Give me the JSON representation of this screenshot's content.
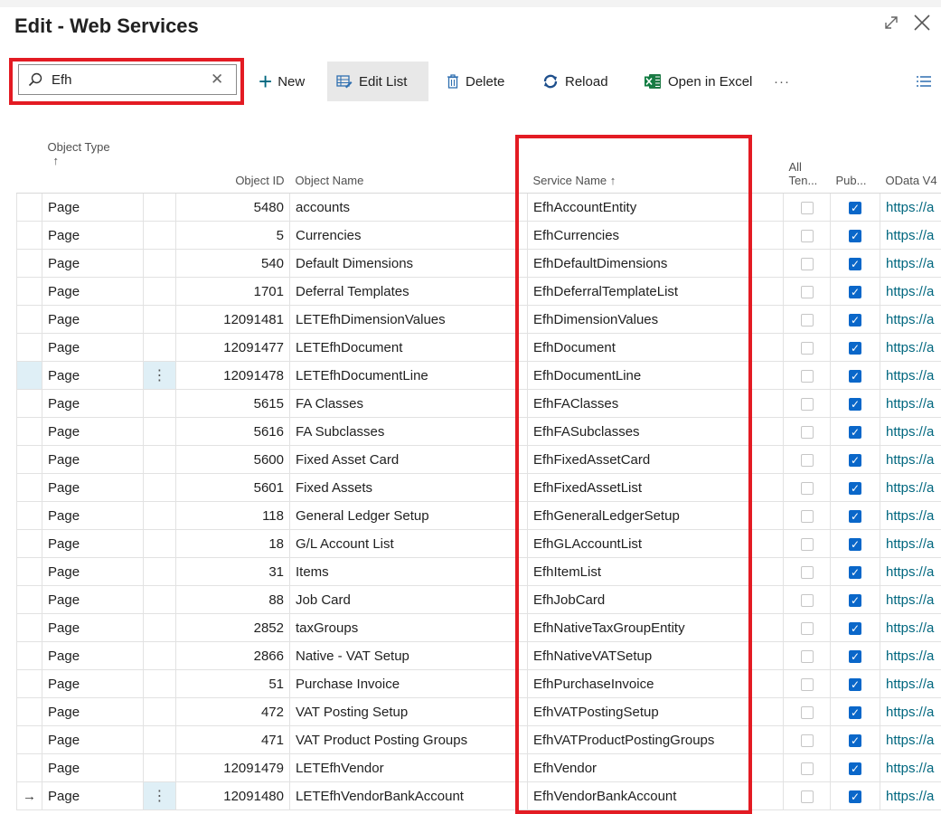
{
  "window": {
    "title": "Edit - Web Services"
  },
  "search": {
    "value": "Efh"
  },
  "toolbar": {
    "new_label": "New",
    "edit_list_label": "Edit List",
    "delete_label": "Delete",
    "reload_label": "Reload",
    "open_excel_label": "Open in Excel",
    "more_label": "···"
  },
  "columns": {
    "object_type": "Object Type",
    "object_type_sort": "↑",
    "object_id": "Object ID",
    "object_name": "Object Name",
    "service_name": "Service Name ↑",
    "all_tenants_line1": "All",
    "all_tenants_line2": "Ten...",
    "published": "Pub...",
    "odata": "OData V4"
  },
  "rows": [
    {
      "type": "Page",
      "id": "5480",
      "name": "accounts",
      "service": "EfhAccountEntity",
      "all_tenants": false,
      "published": true,
      "odata": "https://a"
    },
    {
      "type": "Page",
      "id": "5",
      "name": "Currencies",
      "service": "EfhCurrencies",
      "all_tenants": false,
      "published": true,
      "odata": "https://a"
    },
    {
      "type": "Page",
      "id": "540",
      "name": "Default Dimensions",
      "service": "EfhDefaultDimensions",
      "all_tenants": false,
      "published": true,
      "odata": "https://a"
    },
    {
      "type": "Page",
      "id": "1701",
      "name": "Deferral Templates",
      "service": "EfhDeferralTemplateList",
      "all_tenants": false,
      "published": true,
      "odata": "https://a"
    },
    {
      "type": "Page",
      "id": "12091481",
      "name": "LETEfhDimensionValues",
      "service": "EfhDimensionValues",
      "all_tenants": false,
      "published": true,
      "odata": "https://a"
    },
    {
      "type": "Page",
      "id": "12091477",
      "name": "LETEfhDocument",
      "service": "EfhDocument",
      "all_tenants": false,
      "published": true,
      "odata": "https://a"
    },
    {
      "type": "Page",
      "id": "12091478",
      "name": "LETEfhDocumentLine",
      "service": "EfhDocumentLine",
      "all_tenants": false,
      "published": true,
      "odata": "https://a",
      "selected": true
    },
    {
      "type": "Page",
      "id": "5615",
      "name": "FA Classes",
      "service": "EfhFAClasses",
      "all_tenants": false,
      "published": true,
      "odata": "https://a"
    },
    {
      "type": "Page",
      "id": "5616",
      "name": "FA Subclasses",
      "service": "EfhFASubclasses",
      "all_tenants": false,
      "published": true,
      "odata": "https://a"
    },
    {
      "type": "Page",
      "id": "5600",
      "name": "Fixed Asset Card",
      "service": "EfhFixedAssetCard",
      "all_tenants": false,
      "published": true,
      "odata": "https://a"
    },
    {
      "type": "Page",
      "id": "5601",
      "name": "Fixed Assets",
      "service": "EfhFixedAssetList",
      "all_tenants": false,
      "published": true,
      "odata": "https://a"
    },
    {
      "type": "Page",
      "id": "118",
      "name": "General Ledger Setup",
      "service": "EfhGeneralLedgerSetup",
      "all_tenants": false,
      "published": true,
      "odata": "https://a"
    },
    {
      "type": "Page",
      "id": "18",
      "name": "G/L Account List",
      "service": "EfhGLAccountList",
      "all_tenants": false,
      "published": true,
      "odata": "https://a"
    },
    {
      "type": "Page",
      "id": "31",
      "name": "Items",
      "service": "EfhItemList",
      "all_tenants": false,
      "published": true,
      "odata": "https://a"
    },
    {
      "type": "Page",
      "id": "88",
      "name": "Job Card",
      "service": "EfhJobCard",
      "all_tenants": false,
      "published": true,
      "odata": "https://a"
    },
    {
      "type": "Page",
      "id": "2852",
      "name": "taxGroups",
      "service": "EfhNativeTaxGroupEntity",
      "all_tenants": false,
      "published": true,
      "odata": "https://a"
    },
    {
      "type": "Page",
      "id": "2866",
      "name": "Native - VAT Setup",
      "service": "EfhNativeVATSetup",
      "all_tenants": false,
      "published": true,
      "odata": "https://a"
    },
    {
      "type": "Page",
      "id": "51",
      "name": "Purchase Invoice",
      "service": "EfhPurchaseInvoice",
      "all_tenants": false,
      "published": true,
      "odata": "https://a"
    },
    {
      "type": "Page",
      "id": "472",
      "name": "VAT Posting Setup",
      "service": "EfhVATPostingSetup",
      "all_tenants": false,
      "published": true,
      "odata": "https://a"
    },
    {
      "type": "Page",
      "id": "471",
      "name": "VAT Product Posting Groups",
      "service": "EfhVATProductPostingGroups",
      "all_tenants": false,
      "published": true,
      "odata": "https://a"
    },
    {
      "type": "Page",
      "id": "12091479",
      "name": "LETEfhVendor",
      "service": "EfhVendor",
      "all_tenants": false,
      "published": true,
      "odata": "https://a"
    },
    {
      "type": "Page",
      "id": "12091480",
      "name": "LETEfhVendorBankAccount",
      "service": "EfhVendorBankAccount",
      "all_tenants": false,
      "published": true,
      "odata": "https://a",
      "current": true
    }
  ],
  "colors": {
    "highlight": "#e31b23",
    "accent": "#00677f",
    "checkbox": "#0a67c9",
    "selected_row": "#dfeff6"
  }
}
